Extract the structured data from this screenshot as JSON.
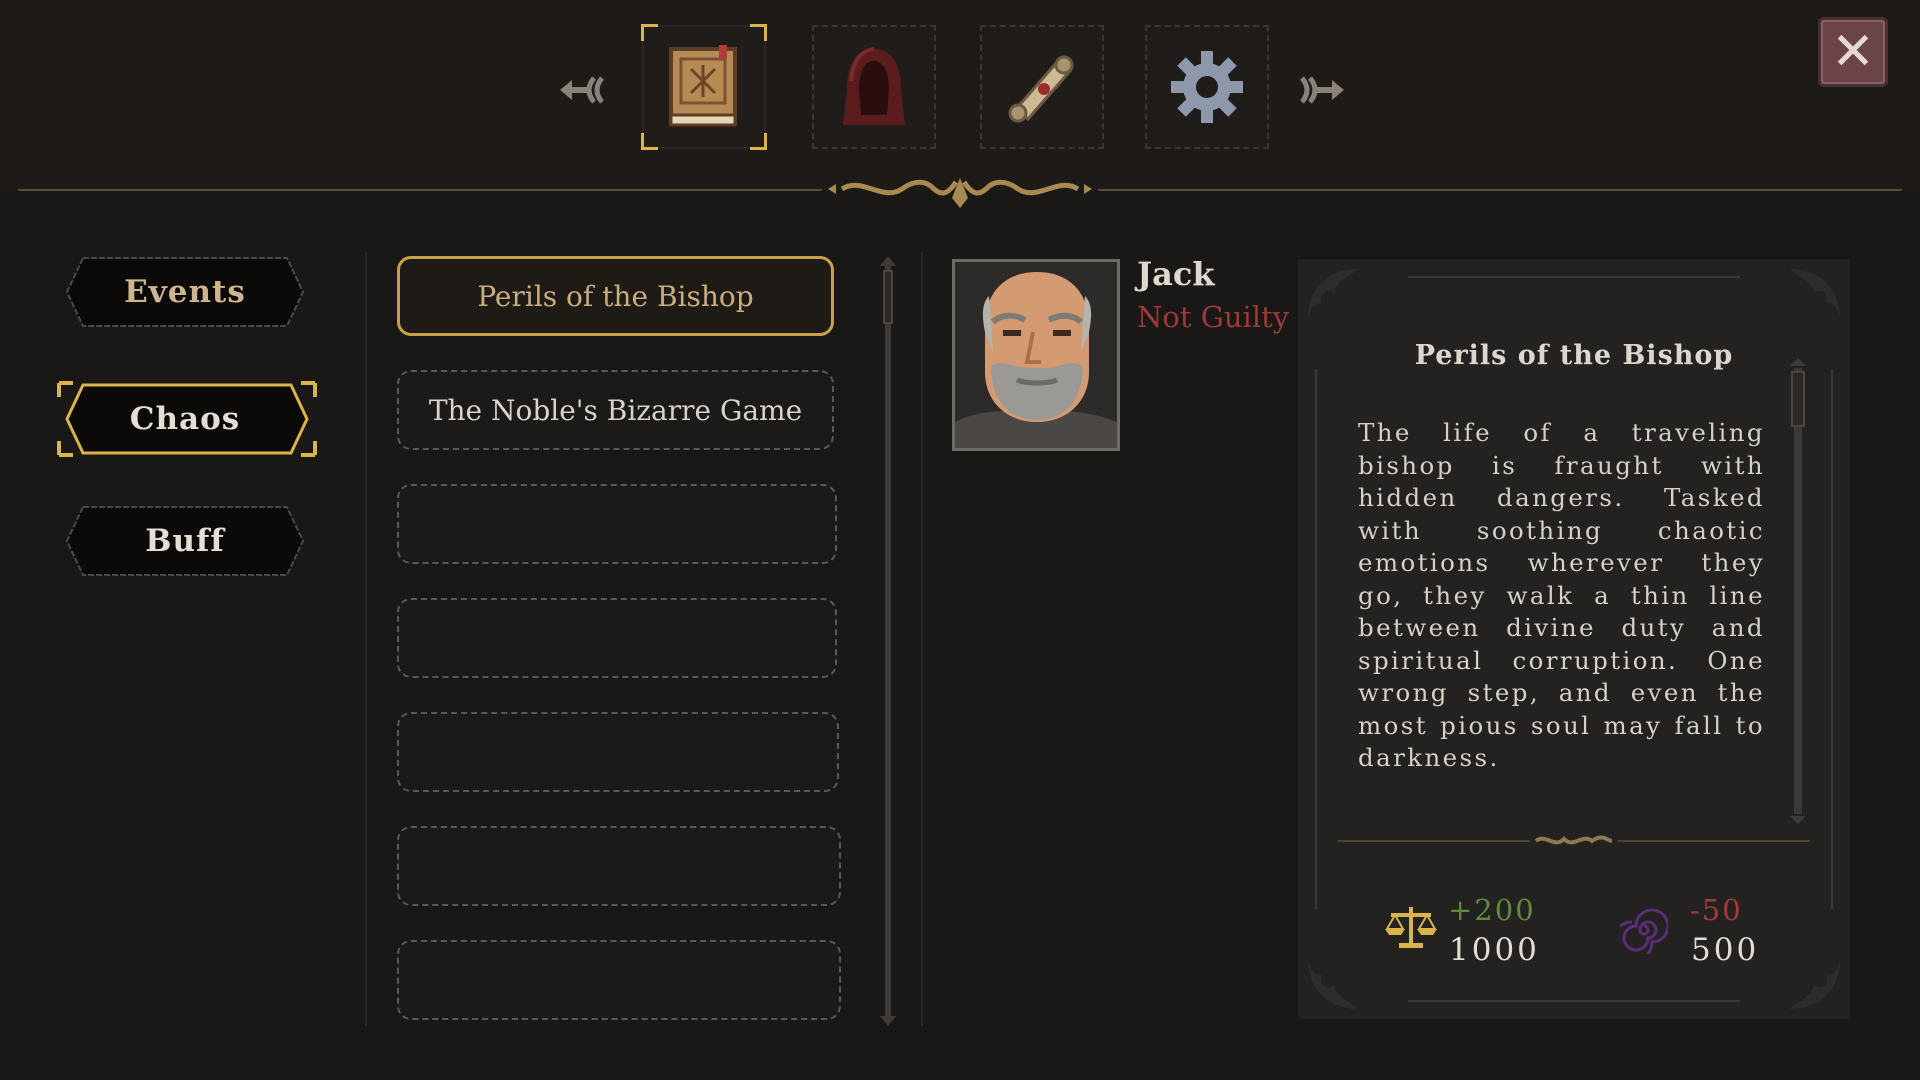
{
  "tabs": [
    {
      "name": "journal-book-icon",
      "active": true
    },
    {
      "name": "hooded-cloak-icon",
      "active": false
    },
    {
      "name": "scroll-icon",
      "active": false
    },
    {
      "name": "gear-icon",
      "active": false
    }
  ],
  "close_symbol": "✕",
  "categories": [
    "Events",
    "Chaos",
    "Buff"
  ],
  "selected_category": "Chaos",
  "event_list": [
    "Perils of the Bishop",
    "The Noble's Bizarre Game",
    "",
    "",
    "",
    "",
    ""
  ],
  "character": {
    "name": "Jack",
    "status": "Not Guilty"
  },
  "detail": {
    "title": "Perils of the Bishop",
    "description": "The life of a traveling bishop is fraught with hidden dangers. Tasked with soothing chaotic emotions wherever they go, they walk a thin line between divine duty and spiritual corruption. One wrong step, and even the most pious soul may fall to darkness.",
    "stats": {
      "justice_change": "+200",
      "justice_value": "1000",
      "chaos_change": "-50",
      "chaos_value": "500"
    }
  },
  "colors": {
    "gold": "#d8b44a",
    "not_guilty_red": "#9b3a3a",
    "positive_green": "#5e8a3a",
    "negative_red": "#a33a3a"
  }
}
